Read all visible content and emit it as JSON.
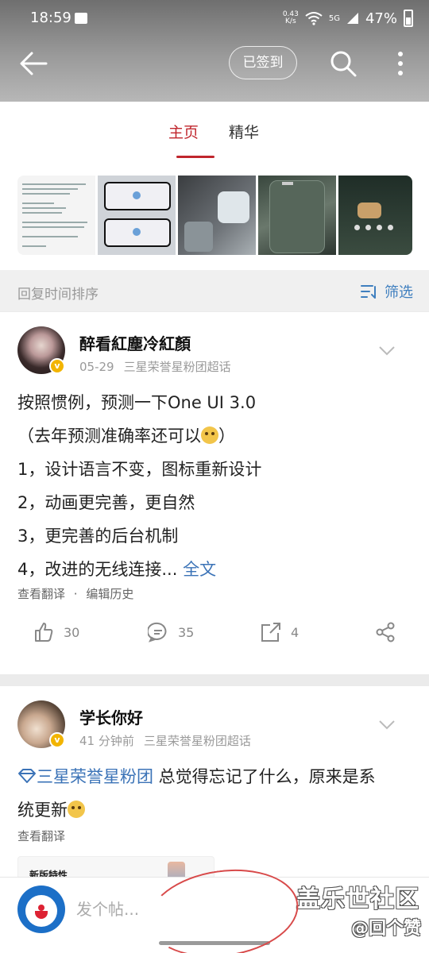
{
  "status_bar": {
    "time": "18:59",
    "net_speed_top": "0.43",
    "net_speed_bottom": "K/s",
    "signal": "5G",
    "battery": "47%"
  },
  "header": {
    "signed_label": "已签到"
  },
  "tabs": [
    {
      "label": "主页",
      "active": true
    },
    {
      "label": "精华",
      "active": false
    }
  ],
  "sort_bar": {
    "label": "回复时间排序",
    "filter_label": "筛选"
  },
  "posts": [
    {
      "username": "醉看紅塵冷紅顏",
      "date": "05-29",
      "group": "三星荣誉星粉团超话",
      "lines": [
        "按照惯例，预测一下One UI 3.0",
        "（去年预测准确率还可以",
        "）",
        "1，设计语言不变，图标重新设计",
        "2，动画更完善，更自然",
        "3，更完善的后台机制",
        "4，改进的无线连接..."
      ],
      "more_link": "全文",
      "translate": "查看翻译",
      "dot": "·",
      "edit_history": "编辑历史",
      "likes": "30",
      "comments": "35",
      "shares": "4"
    },
    {
      "username": "学长你好",
      "date": "41 分钟前",
      "group": "三星荣誉星粉团超话",
      "topic_link": "三星荣誉星粉团",
      "text_a": " 总觉得忘记了什么，原来是系",
      "text_b": "统更新",
      "translate": "查看翻译",
      "card_title": "新版特性"
    }
  ],
  "bottom_bar": {
    "placeholder": "发个帖...",
    "watermark_title": "盖乐世社区",
    "watermark_user": "@回个赞"
  },
  "colors": {
    "accent": "#c0262d",
    "link": "#3b73b7",
    "badge": "#f2b400"
  }
}
